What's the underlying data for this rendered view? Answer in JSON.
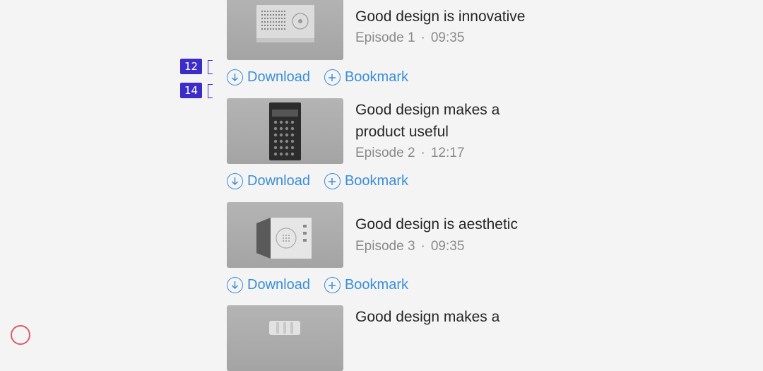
{
  "episodes": [
    {
      "title": "Good design is innovative",
      "episode": "Episode 1",
      "duration": "09:35",
      "thumb": "radio"
    },
    {
      "title": "Good design makes a product useful",
      "episode": "Episode 2",
      "duration": "12:17",
      "thumb": "calculator"
    },
    {
      "title": "Good design is aesthetic",
      "episode": "Episode 3",
      "duration": "09:35",
      "thumb": "speaker"
    },
    {
      "title": "Good design makes a",
      "thumb": "bulb"
    }
  ],
  "actions": {
    "download": "Download",
    "bookmark": "Bookmark"
  },
  "badges": [
    "12",
    "14"
  ],
  "meta_separator": "·",
  "colors": {
    "accent": "#3b8ed8",
    "badge": "#3d2cc9",
    "text": "#262626",
    "muted": "#8a8a8a"
  }
}
